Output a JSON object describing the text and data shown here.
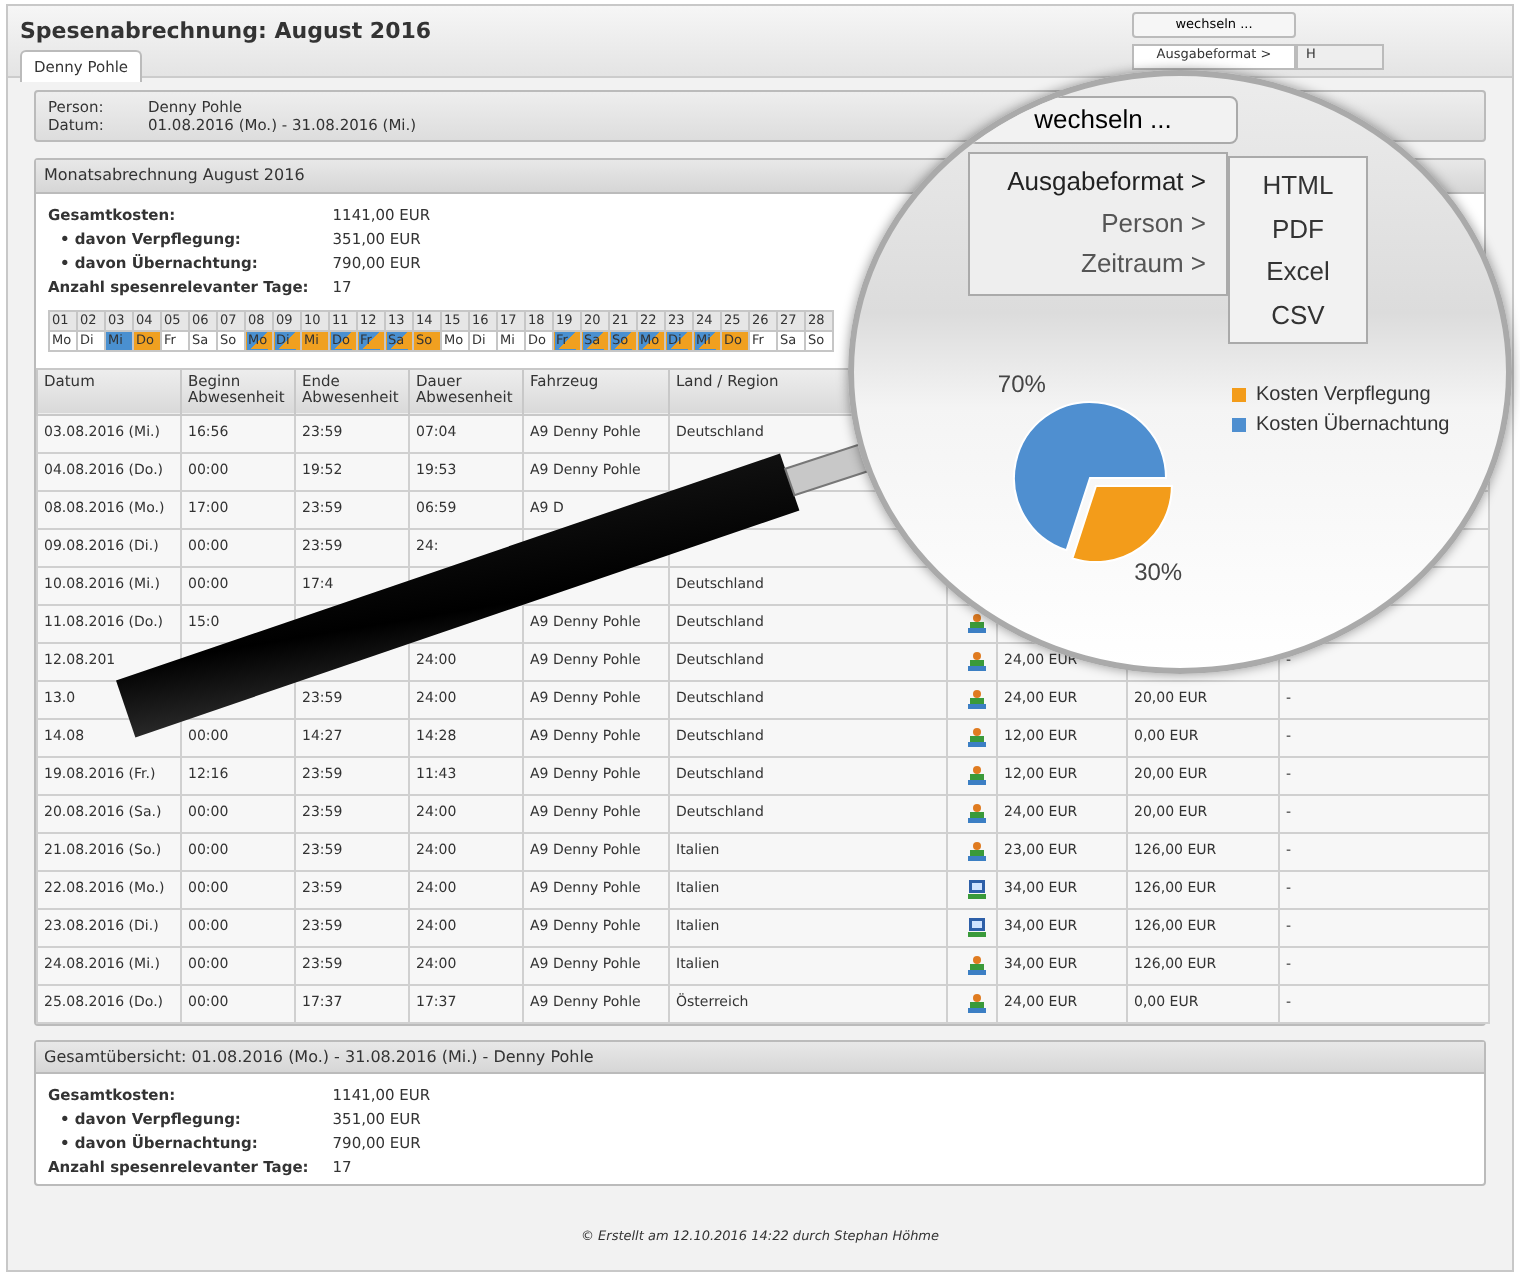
{
  "window": {
    "title": "Spesenabrechnung: August 2016"
  },
  "toolbar": {
    "button": "wechseln ...",
    "menu_tabs": [
      {
        "label": "Ausgabeformat >",
        "selected": true
      },
      {
        "label": "H",
        "selected": false
      }
    ]
  },
  "tabs": [
    {
      "label": "Denny Pohle",
      "selected": true
    }
  ],
  "person_panel": {
    "fields": [
      {
        "label": "Person:",
        "value": "Denny Pohle"
      },
      {
        "label": "Datum:",
        "value": "01.08.2016 (Mo.) - 31.08.2016 (Mi.)"
      }
    ]
  },
  "monthly": {
    "title": "Monatsabrechnung August 2016",
    "summary": [
      {
        "kind": "total",
        "label": "Gesamtkosten:",
        "value": "1141,00 EUR"
      },
      {
        "kind": "sub",
        "label": "• davon Verpflegung:",
        "value": "351,00 EUR"
      },
      {
        "kind": "sub",
        "label": "• davon Übernachtung:",
        "value": "790,00 EUR"
      },
      {
        "kind": "total",
        "label": "Anzahl spesenrelevanter Tage:",
        "value": "17"
      }
    ],
    "calendar": [
      {
        "day": "01",
        "weekday": "Mo"
      },
      {
        "day": "02",
        "weekday": "Di"
      },
      {
        "day": "03",
        "weekday": "Mi",
        "kind": "blue"
      },
      {
        "day": "04",
        "weekday": "Do",
        "kind": "orange"
      },
      {
        "day": "05",
        "weekday": "Fr"
      },
      {
        "day": "06",
        "weekday": "Sa"
      },
      {
        "day": "07",
        "weekday": "So"
      },
      {
        "day": "08",
        "weekday": "Mo",
        "kind": "split"
      },
      {
        "day": "09",
        "weekday": "Di",
        "kind": "split"
      },
      {
        "day": "10",
        "weekday": "Mi",
        "kind": "orange"
      },
      {
        "day": "11",
        "weekday": "Do",
        "kind": "split"
      },
      {
        "day": "12",
        "weekday": "Fr",
        "kind": "split"
      },
      {
        "day": "13",
        "weekday": "Sa",
        "kind": "split"
      },
      {
        "day": "14",
        "weekday": "So",
        "kind": "orange"
      },
      {
        "day": "15",
        "weekday": "Mo"
      },
      {
        "day": "16",
        "weekday": "Di"
      },
      {
        "day": "17",
        "weekday": "Mi"
      },
      {
        "day": "18",
        "weekday": "Do"
      },
      {
        "day": "19",
        "weekday": "Fr",
        "kind": "split"
      },
      {
        "day": "20",
        "weekday": "Sa",
        "kind": "split"
      },
      {
        "day": "21",
        "weekday": "So",
        "kind": "split"
      },
      {
        "day": "22",
        "weekday": "Mo",
        "kind": "split"
      },
      {
        "day": "23",
        "weekday": "Di",
        "kind": "split"
      },
      {
        "day": "24",
        "weekday": "Mi",
        "kind": "split"
      },
      {
        "day": "25",
        "weekday": "Do",
        "kind": "orange"
      },
      {
        "day": "26",
        "weekday": "Fr"
      },
      {
        "day": "27",
        "weekday": "Sa"
      },
      {
        "day": "28",
        "weekday": "So"
      }
    ]
  },
  "table": {
    "columns": [
      "Datum",
      "Beginn Abwesenheit",
      "Ende Abwesenheit",
      "Dauer Abwesenheit",
      "Fahrzeug",
      "Land / Region"
    ],
    "rows": [
      {
        "cells": [
          "03.08.2016 (Mi.)",
          "16:56",
          "23:59",
          "07:04",
          "A9 Denny Pohle",
          "Deutschland",
          null,
          null,
          null
        ]
      },
      {
        "cells": [
          "04.08.2016 (Do.)",
          "00:00",
          "19:52",
          "19:53",
          "A9 Denny Pohle",
          null,
          null,
          null,
          null
        ]
      },
      {
        "cells": [
          "08.08.2016 (Mo.)",
          "17:00",
          "23:59",
          "06:59",
          "A9 D",
          null,
          null,
          null,
          null
        ]
      },
      {
        "cells": [
          "09.08.2016 (Di.)",
          "00:00",
          "23:59",
          "24:",
          null,
          null,
          null,
          null,
          null
        ]
      },
      {
        "cells": [
          "10.08.2016 (Mi.)",
          "00:00",
          "17:4",
          null,
          null,
          "Deutschland",
          null,
          null,
          null
        ]
      },
      {
        "cells": [
          "11.08.2016 (Do.)",
          "15:0",
          null,
          null,
          "A9 Denny Pohle",
          "Deutschland",
          null,
          null,
          null
        ],
        "kind": "person"
      },
      {
        "cells": [
          "12.08.201",
          null,
          null,
          "24:00",
          "A9 Denny Pohle",
          "Deutschland",
          "24,00 EUR",
          null,
          "-"
        ],
        "kind": "person"
      },
      {
        "cells": [
          "13.0",
          null,
          "23:59",
          "24:00",
          "A9 Denny Pohle",
          "Deutschland",
          "24,00 EUR",
          "20,00 EUR",
          "-"
        ],
        "kind": "person"
      },
      {
        "cells": [
          "14.08",
          "00:00",
          "14:27",
          "14:28",
          "A9 Denny Pohle",
          "Deutschland",
          "12,00 EUR",
          "0,00 EUR",
          "-"
        ],
        "kind": "person"
      },
      {
        "cells": [
          "19.08.2016 (Fr.)",
          "12:16",
          "23:59",
          "11:43",
          "A9 Denny Pohle",
          "Deutschland",
          "12,00 EUR",
          "20,00 EUR",
          "-"
        ],
        "kind": "person"
      },
      {
        "cells": [
          "20.08.2016 (Sa.)",
          "00:00",
          "23:59",
          "24:00",
          "A9 Denny Pohle",
          "Deutschland",
          "24,00 EUR",
          "20,00 EUR",
          "-"
        ],
        "kind": "person"
      },
      {
        "cells": [
          "21.08.2016 (So.)",
          "00:00",
          "23:59",
          "24:00",
          "A9 Denny Pohle",
          "Italien",
          "23,00 EUR",
          "126,00 EUR",
          "-"
        ],
        "kind": "person"
      },
      {
        "cells": [
          "22.08.2016 (Mo.)",
          "00:00",
          "23:59",
          "24:00",
          "A9 Denny Pohle",
          "Italien",
          "34,00 EUR",
          "126,00 EUR",
          "-"
        ],
        "kind": "screen"
      },
      {
        "cells": [
          "23.08.2016 (Di.)",
          "00:00",
          "23:59",
          "24:00",
          "A9 Denny Pohle",
          "Italien",
          "34,00 EUR",
          "126,00 EUR",
          "-"
        ],
        "kind": "screen"
      },
      {
        "cells": [
          "24.08.2016 (Mi.)",
          "00:00",
          "23:59",
          "24:00",
          "A9 Denny Pohle",
          "Italien",
          "34,00 EUR",
          "126,00 EUR",
          "-"
        ],
        "kind": "person"
      },
      {
        "cells": [
          "25.08.2016 (Do.)",
          "00:00",
          "17:37",
          "17:37",
          "A9 Denny Pohle",
          "Österreich",
          "24,00 EUR",
          "0,00 EUR",
          "-"
        ],
        "kind": "person"
      }
    ]
  },
  "overview": {
    "title": "Gesamtübersicht: 01.08.2016 (Mo.) - 31.08.2016 (Mi.) - Denny Pohle",
    "summary": [
      {
        "kind": "total",
        "label": "Gesamtkosten:",
        "value": "1141,00 EUR"
      },
      {
        "kind": "sub",
        "label": "• davon Verpflegung:",
        "value": "351,00 EUR"
      },
      {
        "kind": "sub",
        "label": "• davon Übernachtung:",
        "value": "790,00 EUR"
      },
      {
        "kind": "total",
        "label": "Anzahl spesenrelevanter Tage:",
        "value": "17"
      }
    ]
  },
  "footer": "© Erstellt am 12.10.2016 14:22 durch Stephan Höhme",
  "magnifier": {
    "button": "wechseln ...",
    "menu": [
      {
        "label": "Ausgabeformat >",
        "selected": true
      },
      {
        "label": "Person >",
        "selected": false
      },
      {
        "label": "Zeitraum >",
        "selected": false
      }
    ],
    "submenu": [
      "HTML",
      "PDF",
      "Excel",
      "CSV"
    ],
    "chart_data": {
      "type": "pie",
      "categories": [
        "Kosten Verpflegung",
        "Kosten Übernachtung"
      ],
      "series": [
        {
          "values": [
            30,
            70
          ]
        }
      ],
      "value_labels": [
        "30%",
        "70%"
      ]
    }
  }
}
